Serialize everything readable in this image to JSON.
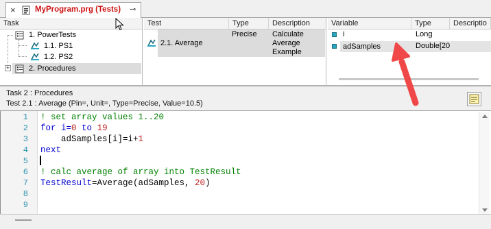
{
  "tab": {
    "close_glyph": "×",
    "title": "MyProgram.prg (Tests)",
    "pin_glyph": "⊸",
    "accent_color": "#cc1111"
  },
  "task_pane": {
    "header": "Task",
    "items": [
      {
        "label": "1. PowerTests",
        "icon": "task-folder-icon"
      },
      {
        "label": "1.1. PS1",
        "icon": "test-icon"
      },
      {
        "label": "1.2. PS2",
        "icon": "test-icon"
      },
      {
        "label": "2. Procedures",
        "icon": "task-folder-icon",
        "expander": "+"
      }
    ]
  },
  "test_pane": {
    "headers": {
      "test": "Test",
      "type": "Type",
      "description": "Description"
    },
    "rows": [
      {
        "test": "2.1. Average",
        "type": "Precise",
        "description": "Calculate Average Example",
        "icon": "test-icon"
      }
    ]
  },
  "variable_pane": {
    "headers": {
      "variable": "Variable",
      "type": "Type",
      "description": "Descriptio"
    },
    "rows": [
      {
        "variable": "i",
        "type": "Long",
        "icon": "variable-icon"
      },
      {
        "variable": "adSamples",
        "type": "Double[20",
        "icon": "variable-icon"
      }
    ]
  },
  "info": {
    "line1": "Task 2 : Procedures",
    "line2": "Test 2.1 : Average (Pin=, Unit=, Type=Precise, Value=10.5)",
    "note_icon": "notes-icon"
  },
  "editor": {
    "line_numbers": [
      "1",
      "2",
      "3",
      "4",
      "5",
      "6",
      "7",
      "8",
      "9"
    ],
    "lines": [
      [
        {
          "t": "! set array values 1..20",
          "c": "cm"
        }
      ],
      [
        {
          "t": "for",
          "c": "kw"
        },
        {
          "t": " i=",
          "c": "kw"
        },
        {
          "t": "0",
          "c": "num"
        },
        {
          "t": " to ",
          "c": "kw"
        },
        {
          "t": "19",
          "c": "num"
        }
      ],
      [
        {
          "t": "    adSamples[i]=i+",
          "c": "tx"
        },
        {
          "t": "1",
          "c": "num"
        }
      ],
      [
        {
          "t": "next",
          "c": "kw"
        }
      ],
      [],
      [
        {
          "t": "! calc average of array into TestResult",
          "c": "cm"
        }
      ],
      [
        {
          "t": "TestResult",
          "c": "kw"
        },
        {
          "t": "=Average(adSamples, ",
          "c": "tx"
        },
        {
          "t": "20",
          "c": "num"
        },
        {
          "t": ")",
          "c": "tx"
        }
      ],
      [],
      []
    ],
    "colors": {
      "keyword": "#0000d0",
      "comment": "#008000",
      "number": "#c02020",
      "line_number": "#2b91af"
    }
  },
  "annotation": {
    "arrow_color": "#f04848"
  }
}
